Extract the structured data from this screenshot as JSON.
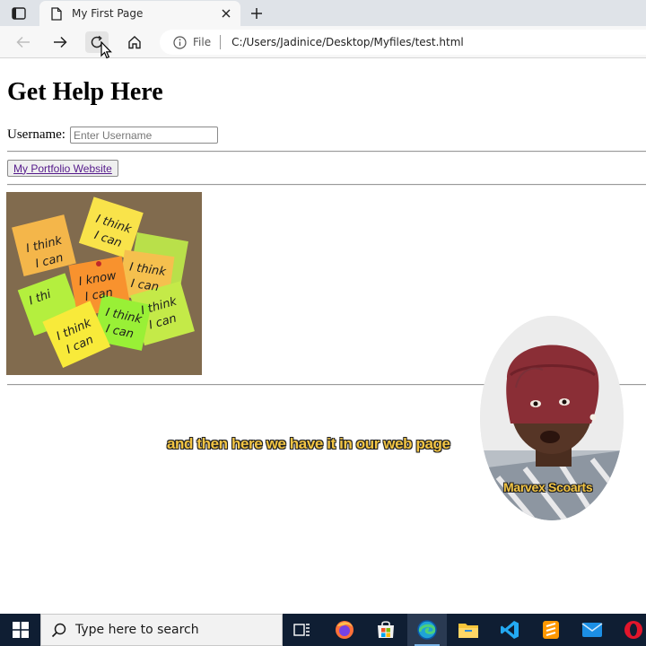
{
  "browser": {
    "tab_title": "My First Page",
    "address": {
      "scheme": "File",
      "url": "C:/Users/Jadinice/Desktop/Myfiles/test.html"
    }
  },
  "page": {
    "heading": "Get Help Here",
    "username_label": "Username:",
    "username_placeholder": "Enter Username",
    "portfolio_link": "My Portfolio Website",
    "image_alt": "sticky notes reading I think I can and I know I can",
    "sticky_notes": [
      "I think",
      "I can",
      "I think",
      "I can",
      "I know",
      "I can",
      "I think",
      "I can",
      "I thi",
      "I think",
      "I can",
      "I think",
      "I can",
      "I think",
      "I can"
    ]
  },
  "overlay": {
    "caption": "and then here we have it in our web page",
    "presenter_name": "Marvex Scoarts"
  },
  "taskbar": {
    "search_placeholder": "Type here to search",
    "apps": [
      "task-view",
      "firefox",
      "microsoft-store",
      "edge",
      "file-explorer",
      "vscode",
      "sublime-text",
      "mail",
      "opera"
    ]
  }
}
